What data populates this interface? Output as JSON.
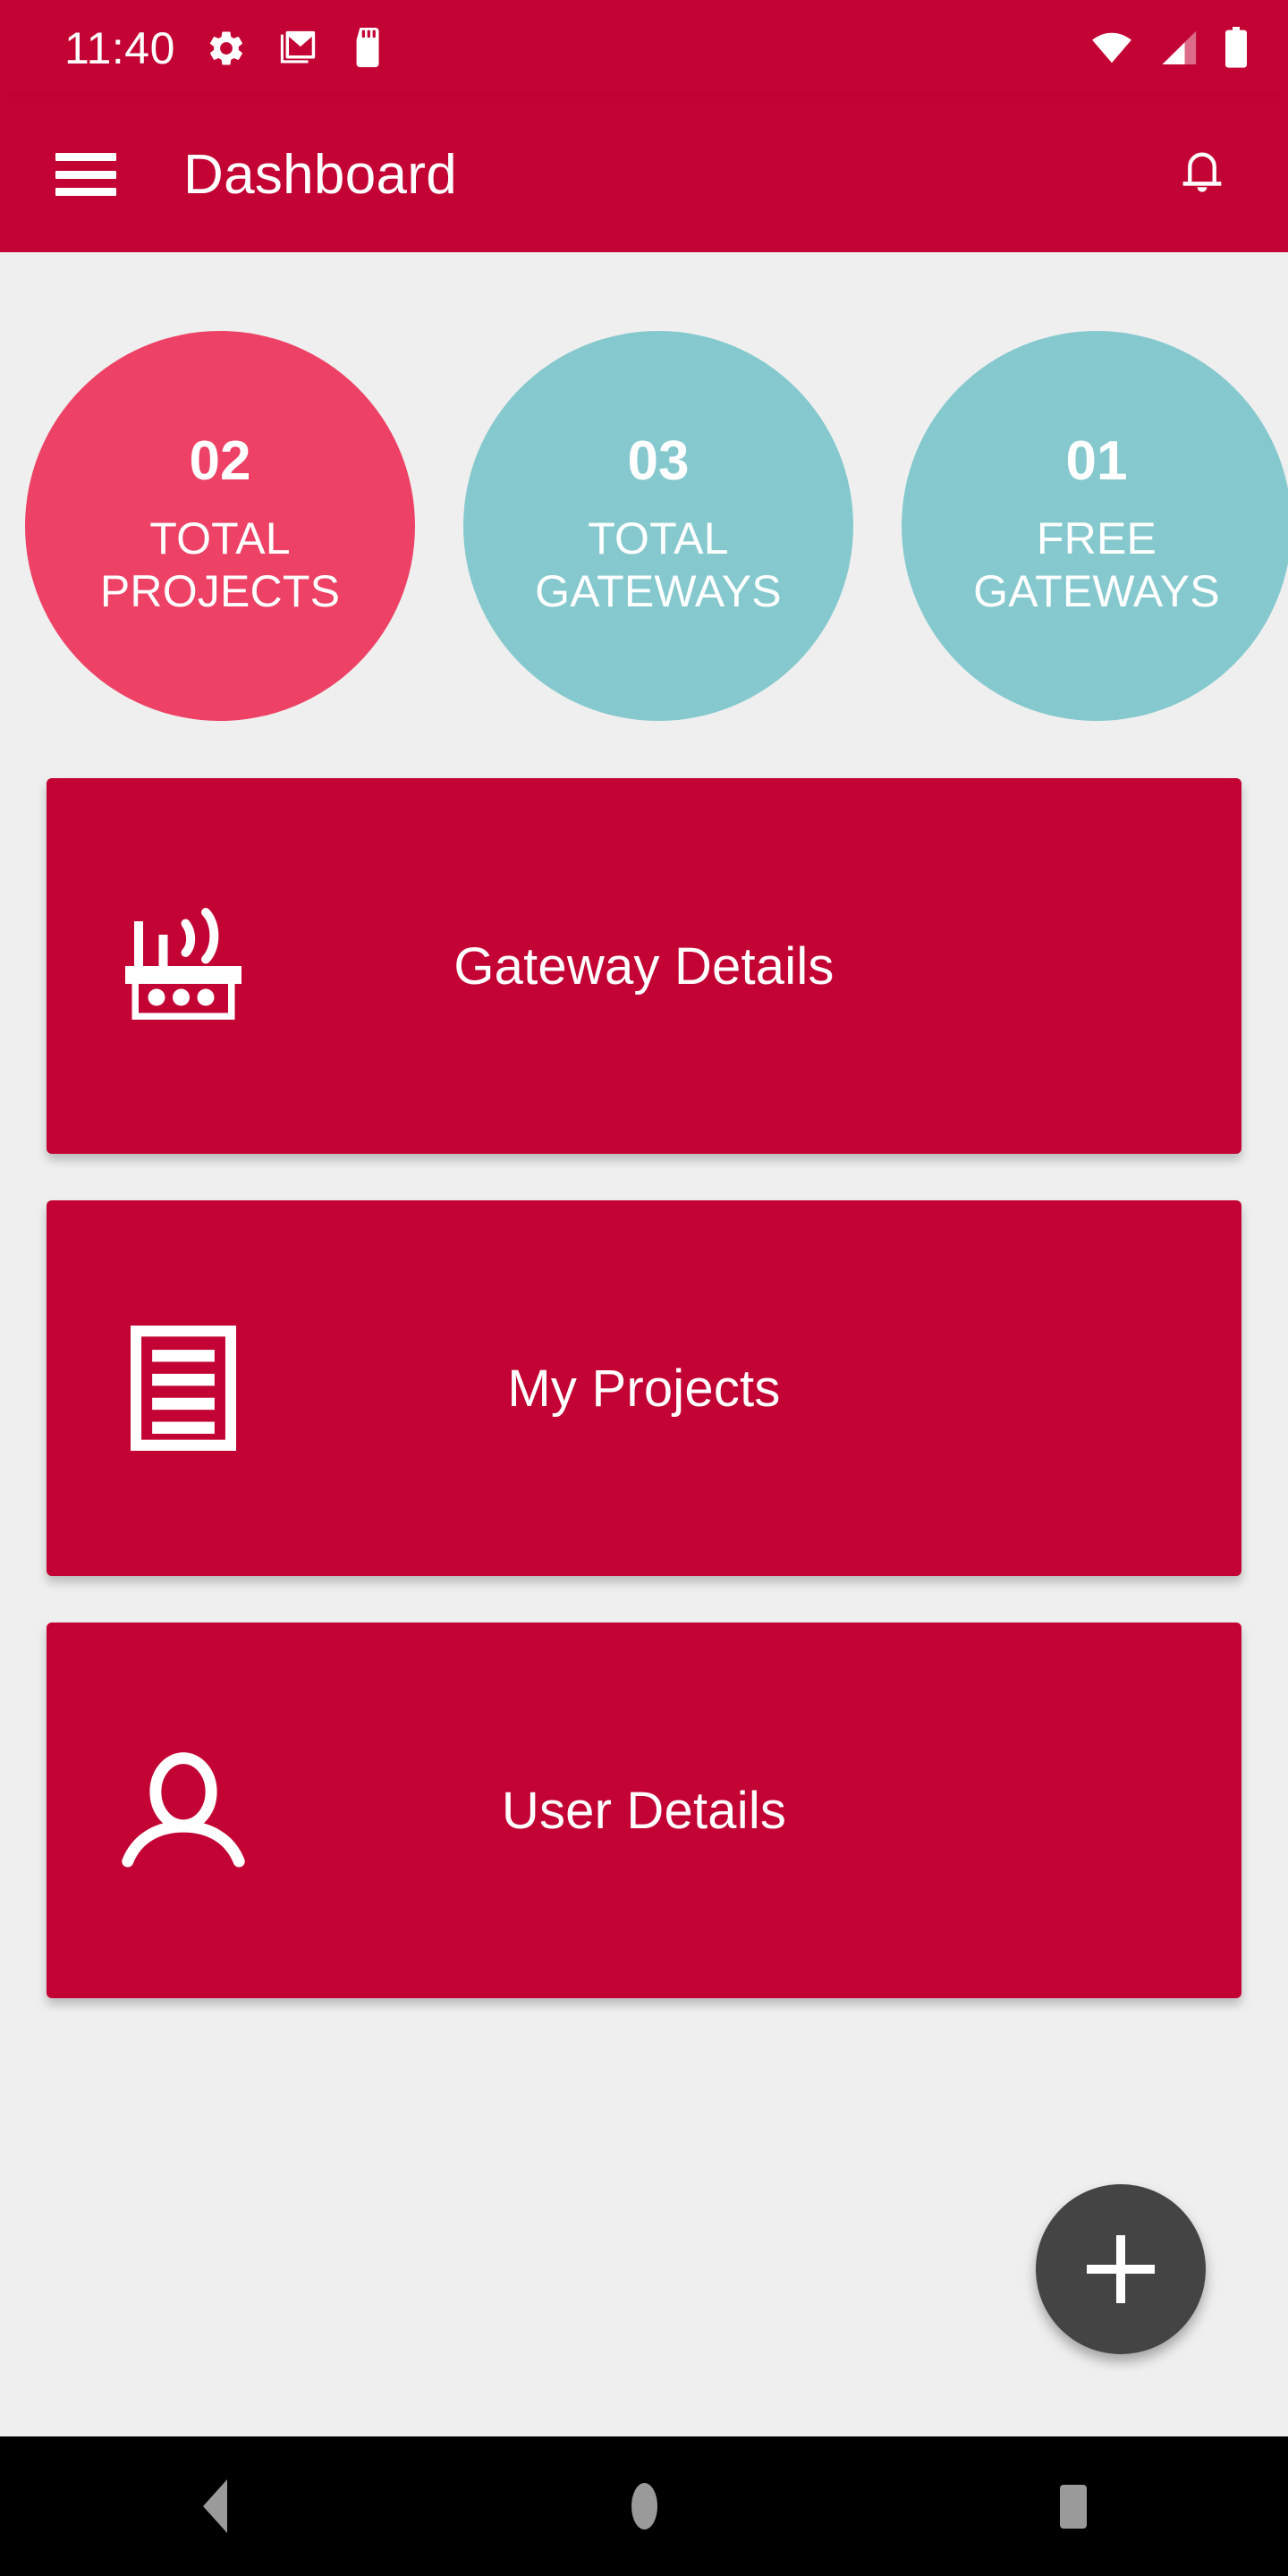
{
  "status_bar": {
    "clock": "11:40",
    "left_icons": [
      "gear-icon",
      "gmail-icon",
      "sd-card-icon"
    ],
    "right_icons": [
      "wifi-icon",
      "cellular-signal-icon",
      "battery-icon"
    ],
    "background_color": "#C30333"
  },
  "app_bar": {
    "menu_icon": "hamburger-menu-icon",
    "title": "Dashboard",
    "notification_icon": "bell-icon",
    "background_color": "#C30333",
    "text_color": "#FFFFFF"
  },
  "stats": [
    {
      "value": "02",
      "label_line1": "TOTAL",
      "label_line2": "PROJECTS",
      "color": "#ED4165"
    },
    {
      "value": "03",
      "label_line1": "TOTAL",
      "label_line2": "GATEWAYS",
      "color": "#85C9CE"
    },
    {
      "value": "01",
      "label_line1": "FREE",
      "label_line2": "GATEWAYS",
      "color": "#85C9CE"
    }
  ],
  "menu_cards": [
    {
      "title": "Gateway Details",
      "icon": "router-icon",
      "color": "#C30333"
    },
    {
      "title": "My Projects",
      "icon": "document-list-icon",
      "color": "#C30333"
    },
    {
      "title": "User Details",
      "icon": "person-icon",
      "color": "#C30333"
    }
  ],
  "fab": {
    "icon": "plus-icon",
    "color": "#444444"
  },
  "nav_bar": {
    "back": "back-triangle-icon",
    "home": "home-circle-icon",
    "recents": "recents-square-icon",
    "background_color": "#000000",
    "icon_color": "#9A9A9A"
  }
}
